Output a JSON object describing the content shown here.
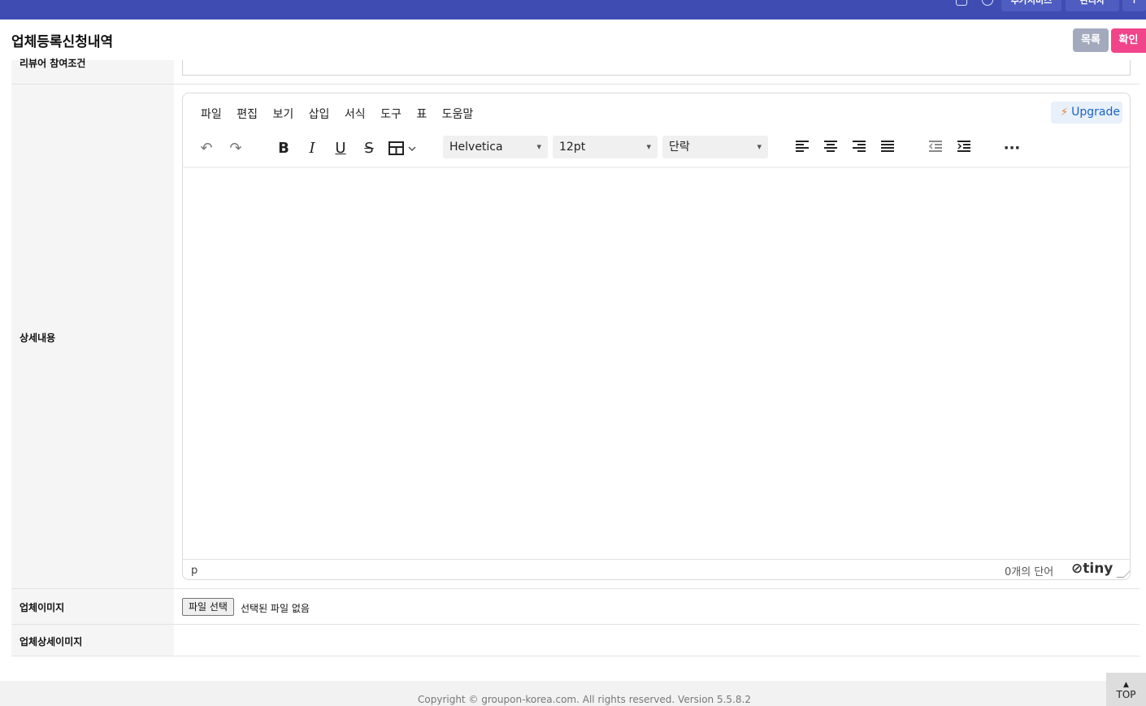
{
  "topbar": {
    "btn1_label": "추가서비스",
    "btn2_label": "관리자",
    "btn3_label": "↑"
  },
  "header": {
    "title": "업체등록신청내역",
    "list_button": "목록",
    "confirm_button": "확인"
  },
  "rows": {
    "prev_label": "리뷰어 참여조건",
    "detail_label": "상세내용",
    "image_label": "업체이미지",
    "detail_image_label": "업체상세이미지"
  },
  "editor": {
    "menu": [
      "파일",
      "편집",
      "보기",
      "삽입",
      "서식",
      "도구",
      "표",
      "도움말"
    ],
    "upgrade": "Upgrade",
    "font_family": "Helvetica",
    "font_size": "12pt",
    "block_format": "단락",
    "status_path": "p",
    "word_count": "0개의 단어",
    "brand": "tiny"
  },
  "file_input": {
    "button": "파일 선택",
    "status": "선택된 파일 없음"
  },
  "footer": {
    "copyright": "Copyright © groupon-korea.com. All rights reserved. Version 5.5.8.2",
    "top_button": "TOP"
  }
}
